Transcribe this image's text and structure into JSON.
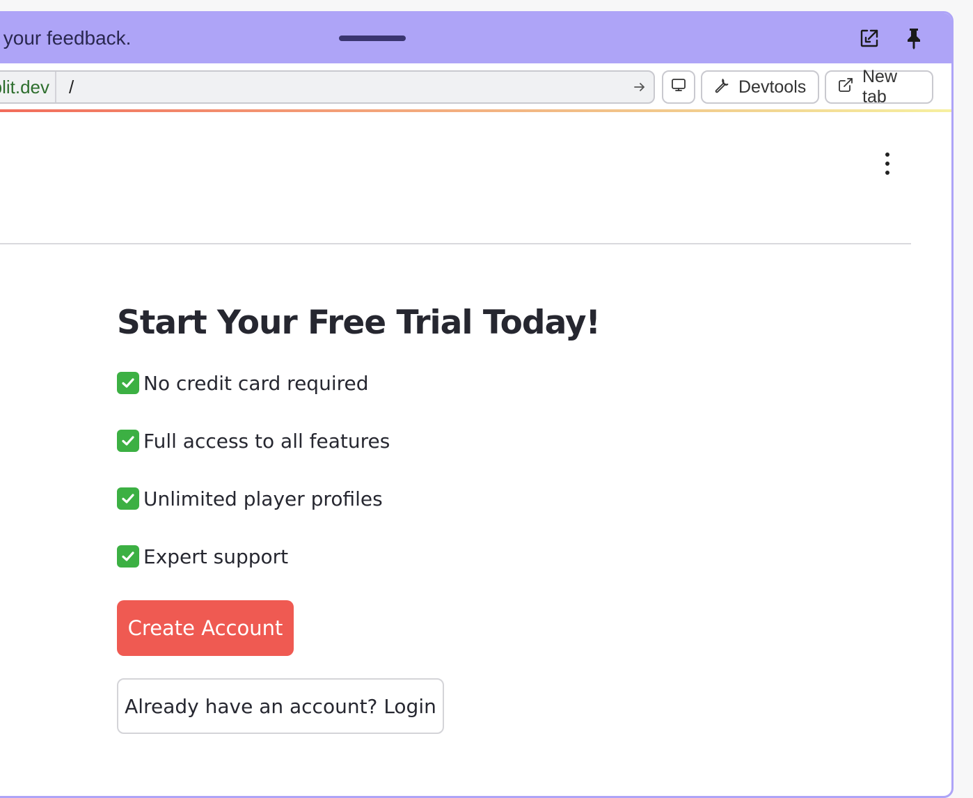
{
  "topbar": {
    "feedback_text": "s your feedback.",
    "icons": [
      "open-in-window-icon",
      "pin-icon"
    ],
    "background": "#aea4f7"
  },
  "addressbar": {
    "domain": "plit.dev",
    "path": "/",
    "screen_icon": "monitor-icon",
    "devtools_label": "Devtools",
    "newtab_label": "New tab"
  },
  "page": {
    "title": "Start Your Free Trial Today!",
    "features": [
      "No credit card required",
      "Full access to all features",
      "Unlimited player profiles",
      "Expert support"
    ],
    "primary_button": "Create Account",
    "secondary_button": "Already have an account? Login",
    "accent_color": "#ef5a52",
    "check_color": "#3cb043"
  }
}
